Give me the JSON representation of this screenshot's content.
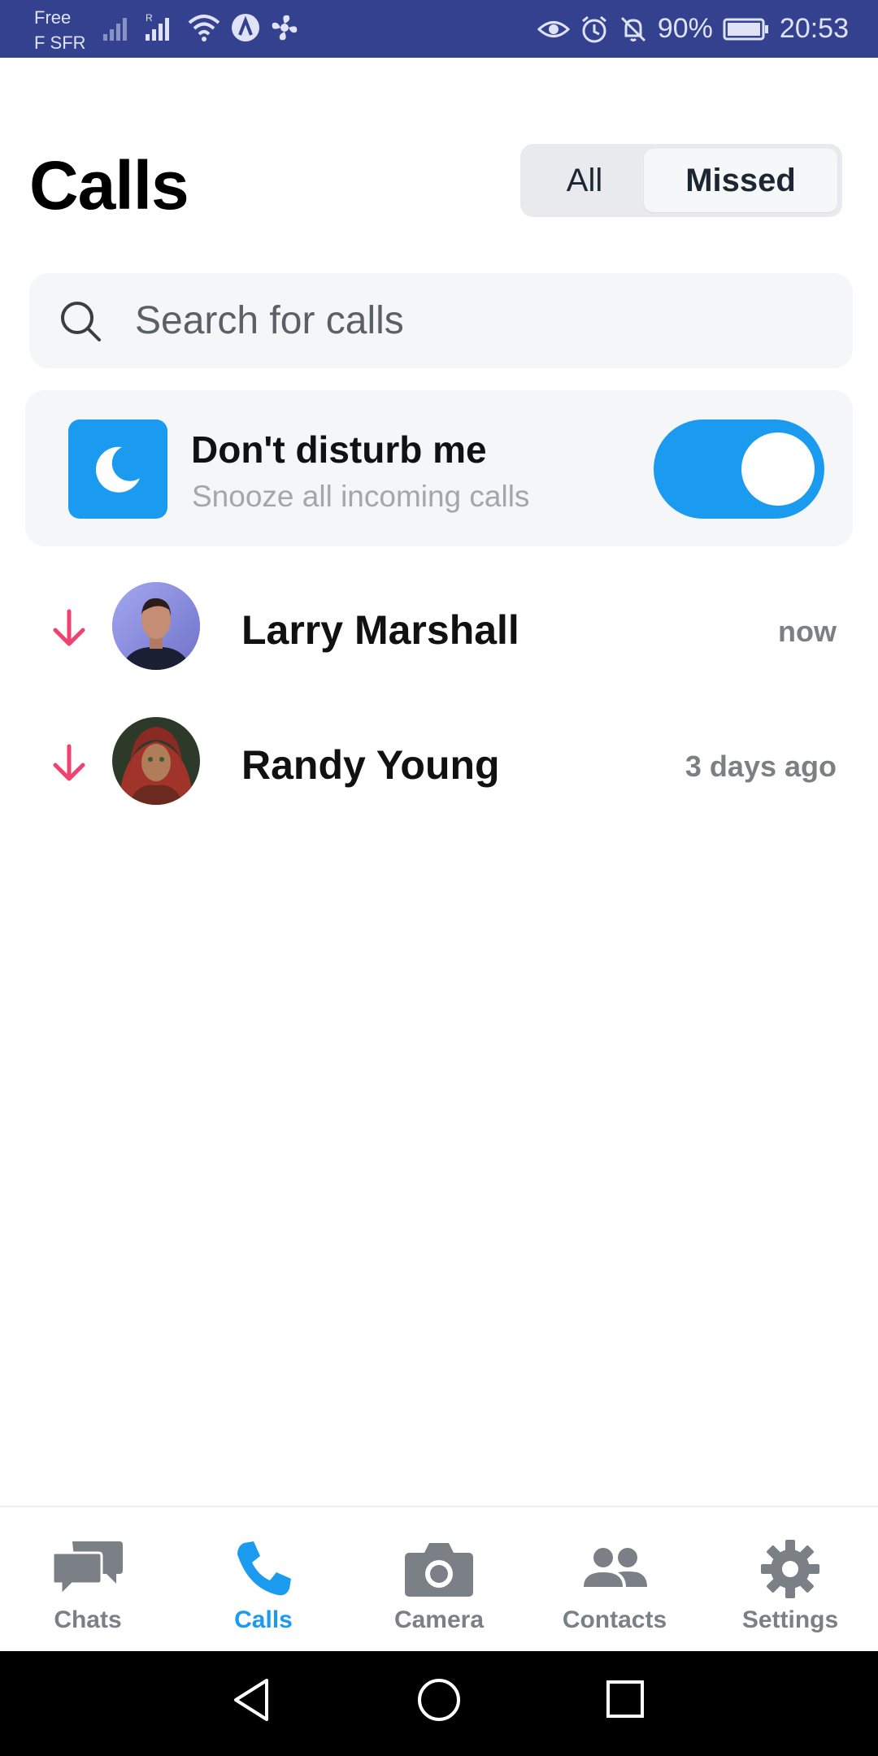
{
  "status_bar": {
    "carrier_line1": "Free",
    "carrier_line2": "F SFR",
    "battery": "90%",
    "time": "20:53",
    "colors": {
      "background": "#33418f"
    }
  },
  "header": {
    "title": "Calls",
    "tabs": [
      {
        "label": "All",
        "active": false
      },
      {
        "label": "Missed",
        "active": true
      }
    ]
  },
  "search": {
    "placeholder": "Search for calls",
    "value": ""
  },
  "dnd": {
    "title": "Don't disturb me",
    "subtitle": "Snooze all incoming calls",
    "enabled": true,
    "icon": "moon-icon"
  },
  "calls": [
    {
      "name": "Larry Marshall",
      "time": "now",
      "type": "missed-incoming",
      "icon": "arrow-down-icon"
    },
    {
      "name": "Randy Young",
      "time": "3 days ago",
      "type": "missed-incoming",
      "icon": "arrow-down-icon"
    }
  ],
  "bottom_nav": {
    "items": [
      {
        "label": "Chats",
        "icon": "chat-bubbles-icon",
        "active": false
      },
      {
        "label": "Calls",
        "icon": "phone-icon",
        "active": true
      },
      {
        "label": "Camera",
        "icon": "camera-icon",
        "active": false
      },
      {
        "label": "Contacts",
        "icon": "contacts-icon",
        "active": false
      },
      {
        "label": "Settings",
        "icon": "gear-icon",
        "active": false
      }
    ]
  },
  "colors": {
    "accent": "#1a9bf0",
    "missed_arrow": "#f0426f",
    "muted_text": "#7d7f83"
  }
}
